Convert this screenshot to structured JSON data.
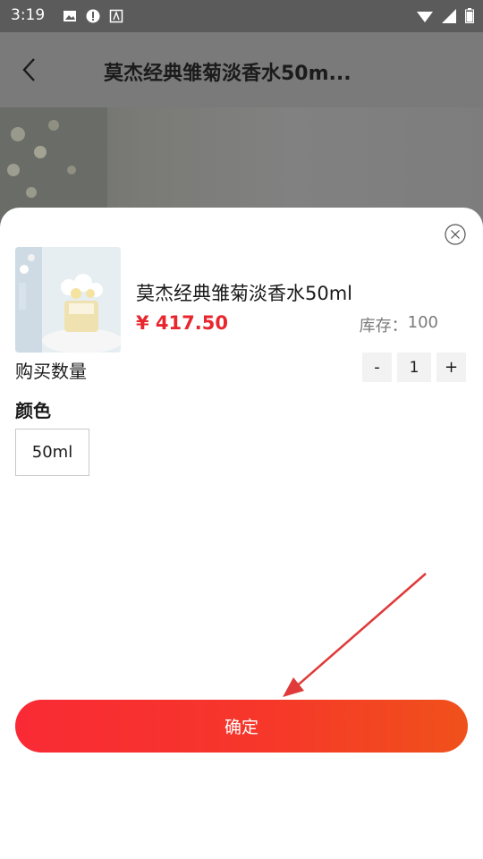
{
  "status_bar": {
    "time": "3:19",
    "left_icons": [
      "image-icon",
      "alert-icon",
      "app-icon"
    ],
    "right_icons": [
      "wifi-icon",
      "signal-icon",
      "battery-icon"
    ]
  },
  "header": {
    "title": "莫杰经典雏菊淡香水50m...",
    "back_icon": "chevron-left-icon"
  },
  "sheet": {
    "close_icon": "close-circle-icon",
    "product": {
      "name": "莫杰经典雏菊淡香水50ml",
      "price": "¥ 417.50",
      "stock_label": "库存：",
      "stock_value": "100"
    },
    "quantity": {
      "label": "购买数量",
      "minus": "-",
      "value": "1",
      "plus": "+"
    },
    "option_group": {
      "label": "颜色",
      "options": [
        "50ml"
      ]
    },
    "confirm_label": "确定"
  },
  "colors": {
    "accent": "#e8262d",
    "button_gradient_start": "#f92a35",
    "button_gradient_end": "#f0511b",
    "annotation_arrow": "#e03a3a"
  }
}
